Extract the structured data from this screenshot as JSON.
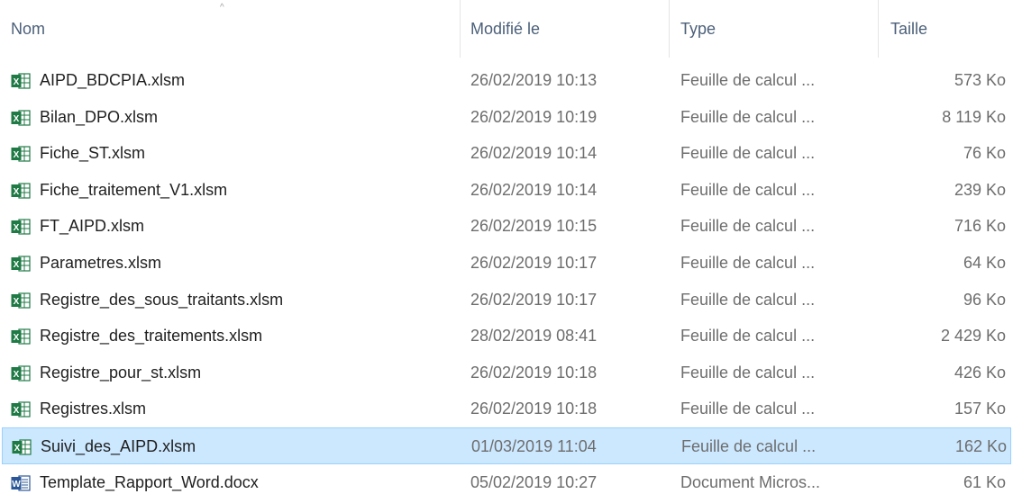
{
  "header": {
    "name_label": "Nom",
    "date_label": "Modifié le",
    "type_label": "Type",
    "size_label": "Taille",
    "sort_indicator": "^"
  },
  "files": [
    {
      "name": "AIPD_BDCPIA.xlsm",
      "date": "26/02/2019 10:13",
      "type": "Feuille de calcul ...",
      "size": "573 Ko",
      "icon": "excel-icon",
      "selected": false
    },
    {
      "name": "Bilan_DPO.xlsm",
      "date": "26/02/2019 10:19",
      "type": "Feuille de calcul ...",
      "size": "8 119 Ko",
      "icon": "excel-icon",
      "selected": false
    },
    {
      "name": "Fiche_ST.xlsm",
      "date": "26/02/2019 10:14",
      "type": "Feuille de calcul ...",
      "size": "76 Ko",
      "icon": "excel-icon",
      "selected": false
    },
    {
      "name": "Fiche_traitement_V1.xlsm",
      "date": "26/02/2019 10:14",
      "type": "Feuille de calcul ...",
      "size": "239 Ko",
      "icon": "excel-icon",
      "selected": false
    },
    {
      "name": "FT_AIPD.xlsm",
      "date": "26/02/2019 10:15",
      "type": "Feuille de calcul ...",
      "size": "716 Ko",
      "icon": "excel-icon",
      "selected": false
    },
    {
      "name": "Parametres.xlsm",
      "date": "26/02/2019 10:17",
      "type": "Feuille de calcul ...",
      "size": "64 Ko",
      "icon": "excel-icon",
      "selected": false
    },
    {
      "name": "Registre_des_sous_traitants.xlsm",
      "date": "26/02/2019 10:17",
      "type": "Feuille de calcul ...",
      "size": "96 Ko",
      "icon": "excel-icon",
      "selected": false
    },
    {
      "name": "Registre_des_traitements.xlsm",
      "date": "28/02/2019 08:41",
      "type": "Feuille de calcul ...",
      "size": "2 429 Ko",
      "icon": "excel-icon",
      "selected": false
    },
    {
      "name": "Registre_pour_st.xlsm",
      "date": "26/02/2019 10:18",
      "type": "Feuille de calcul ...",
      "size": "426 Ko",
      "icon": "excel-icon",
      "selected": false
    },
    {
      "name": "Registres.xlsm",
      "date": "26/02/2019 10:18",
      "type": "Feuille de calcul ...",
      "size": "157 Ko",
      "icon": "excel-icon",
      "selected": false
    },
    {
      "name": "Suivi_des_AIPD.xlsm",
      "date": "01/03/2019 11:04",
      "type": "Feuille de calcul ...",
      "size": "162 Ko",
      "icon": "excel-icon",
      "selected": true
    },
    {
      "name": "Template_Rapport_Word.docx",
      "date": "05/02/2019 10:27",
      "type": "Document Micros...",
      "size": "61 Ko",
      "icon": "word-icon",
      "selected": false
    }
  ],
  "colors": {
    "excel_green": "#1f7a45",
    "word_blue": "#2b579a",
    "selection_bg": "#cce8ff",
    "selection_border": "#99d1ff"
  }
}
